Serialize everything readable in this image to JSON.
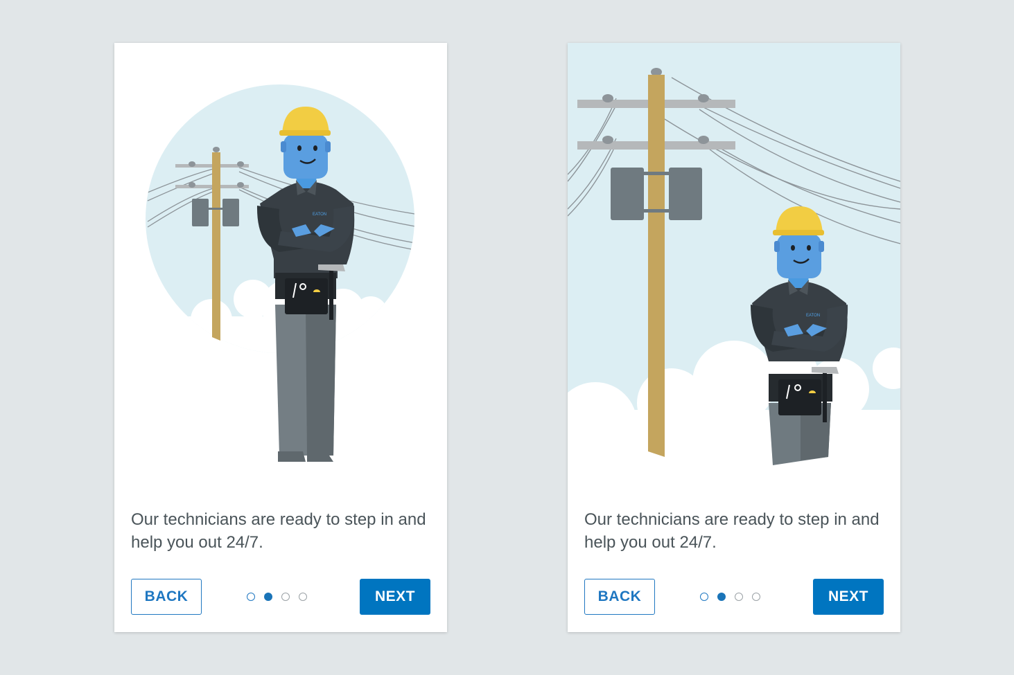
{
  "screens": [
    {
      "variant": "circle-scene",
      "message": "Our technicians are ready to step in and help you out 24/7.",
      "back_label": "BACK",
      "next_label": "NEXT",
      "pagination": {
        "total": 4,
        "current": 2
      }
    },
    {
      "variant": "full-sky-scene",
      "message": "Our technicians are ready to step in and help you out 24/7.",
      "back_label": "BACK",
      "next_label": "NEXT",
      "pagination": {
        "total": 4,
        "current": 2
      }
    }
  ],
  "colors": {
    "page_background": "#e1e6e8",
    "accent": "#0075c0",
    "sky": "#dceef3",
    "helmet": "#f2cd43",
    "skin": "#5a9ee0",
    "shirt": "#383f45",
    "pants": "#6f7a80",
    "pole": "#c4a55e"
  },
  "logo_text": "EATON"
}
